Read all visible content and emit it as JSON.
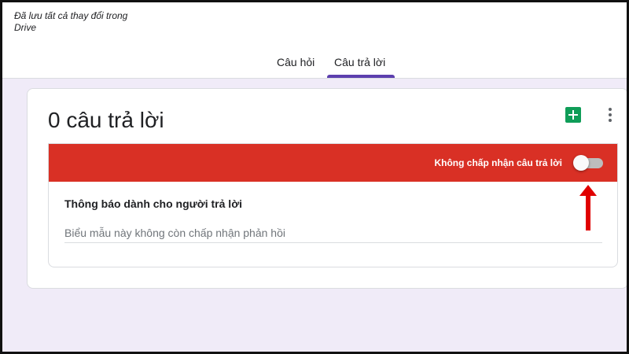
{
  "header": {
    "save_status": "Đã lưu tất cả thay đổi trong Drive"
  },
  "tabs": [
    {
      "label": "Câu hỏi",
      "active": false
    },
    {
      "label": "Câu trả lời",
      "active": true
    }
  ],
  "responses": {
    "count_title": "0 câu trả lời",
    "sheets_icon": "google-sheets-icon",
    "more_icon": "more-vert-icon",
    "accepting_label": "Không chấp nhận câu trả lời",
    "accepting": false,
    "message_title": "Thông báo dành cho người trả lời",
    "message_value": "",
    "message_placeholder": "Biểu mẫu này không còn chấp nhận phản hồi"
  },
  "colors": {
    "banner": "#d93025",
    "accent": "#5c3fae",
    "sheets": "#0f9d58",
    "annotation_arrow": "#e00000"
  }
}
